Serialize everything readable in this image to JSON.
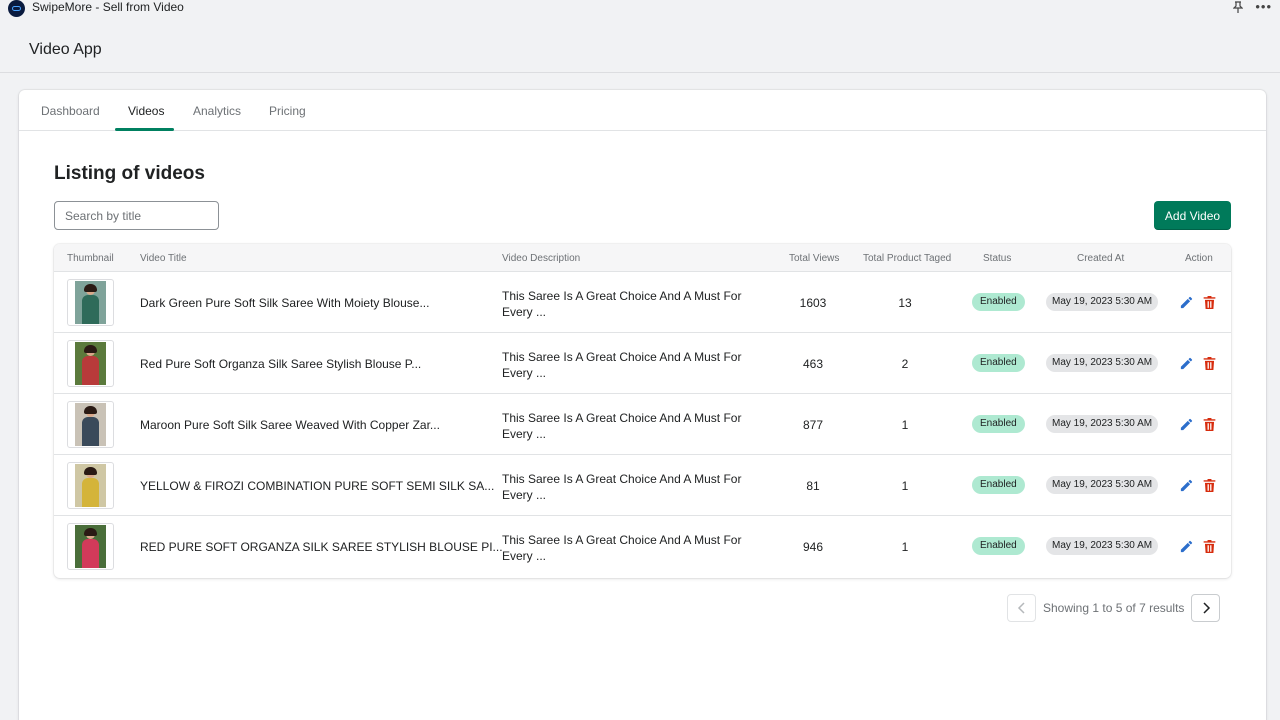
{
  "window": {
    "title": "SwipeMore - Sell from Video"
  },
  "app": {
    "title": "Video App"
  },
  "tabs": [
    {
      "label": "Dashboard"
    },
    {
      "label": "Videos"
    },
    {
      "label": "Analytics"
    },
    {
      "label": "Pricing"
    }
  ],
  "listing": {
    "title": "Listing of videos",
    "search_placeholder": "Search by title",
    "add_button": "Add Video"
  },
  "table": {
    "headers": {
      "thumbnail": "Thumbnail",
      "title": "Video Title",
      "description": "Video Description",
      "views": "Total Views",
      "tagged": "Total Product Taged",
      "status": "Status",
      "created": "Created At",
      "action": "Action"
    },
    "rows": [
      {
        "title": "Dark Green Pure Soft Silk Saree With Moiety Blouse...",
        "desc": "This Saree Is A Great Choice And A Must For Every ...",
        "views": "1603",
        "tagged": "13",
        "status": "Enabled",
        "created": "May 19, 2023 5:30 AM"
      },
      {
        "title": "Red Pure Soft Organza Silk Saree Stylish Blouse P...",
        "desc": "This Saree Is A Great Choice And A Must For Every ...",
        "views": "463",
        "tagged": "2",
        "status": "Enabled",
        "created": "May 19, 2023 5:30 AM"
      },
      {
        "title": "Maroon Pure Soft Silk Saree Weaved With Copper Zar...",
        "desc": "This Saree Is A Great Choice And A Must For Every ...",
        "views": "877",
        "tagged": "1",
        "status": "Enabled",
        "created": "May 19, 2023 5:30 AM"
      },
      {
        "title": "YELLOW & FIROZI COMBINATION PURE SOFT SEMI SILK SA...",
        "desc": "This Saree Is A Great Choice And A Must For Every ...",
        "views": "81",
        "tagged": "1",
        "status": "Enabled",
        "created": "May 19, 2023 5:30 AM"
      },
      {
        "title": "RED PURE SOFT ORGANZA SILK SAREE STYLISH BLOUSE PI...",
        "desc": "This Saree Is A Great Choice And A Must For Every ...",
        "views": "946",
        "tagged": "1",
        "status": "Enabled",
        "created": "May 19, 2023 5:30 AM"
      }
    ]
  },
  "pagination": {
    "text": "Showing 1 to 5 of 7 results"
  },
  "colors": {
    "accent": "#008060",
    "button": "#007a5a",
    "status_enabled": "#aee9d1",
    "edit_icon": "#2c6ecb",
    "delete_icon": "#d72c0d"
  },
  "icons": [
    "app-logo-icon",
    "pin-icon",
    "more-icon",
    "edit-icon",
    "delete-icon",
    "chevron-left-icon",
    "chevron-right-icon"
  ]
}
